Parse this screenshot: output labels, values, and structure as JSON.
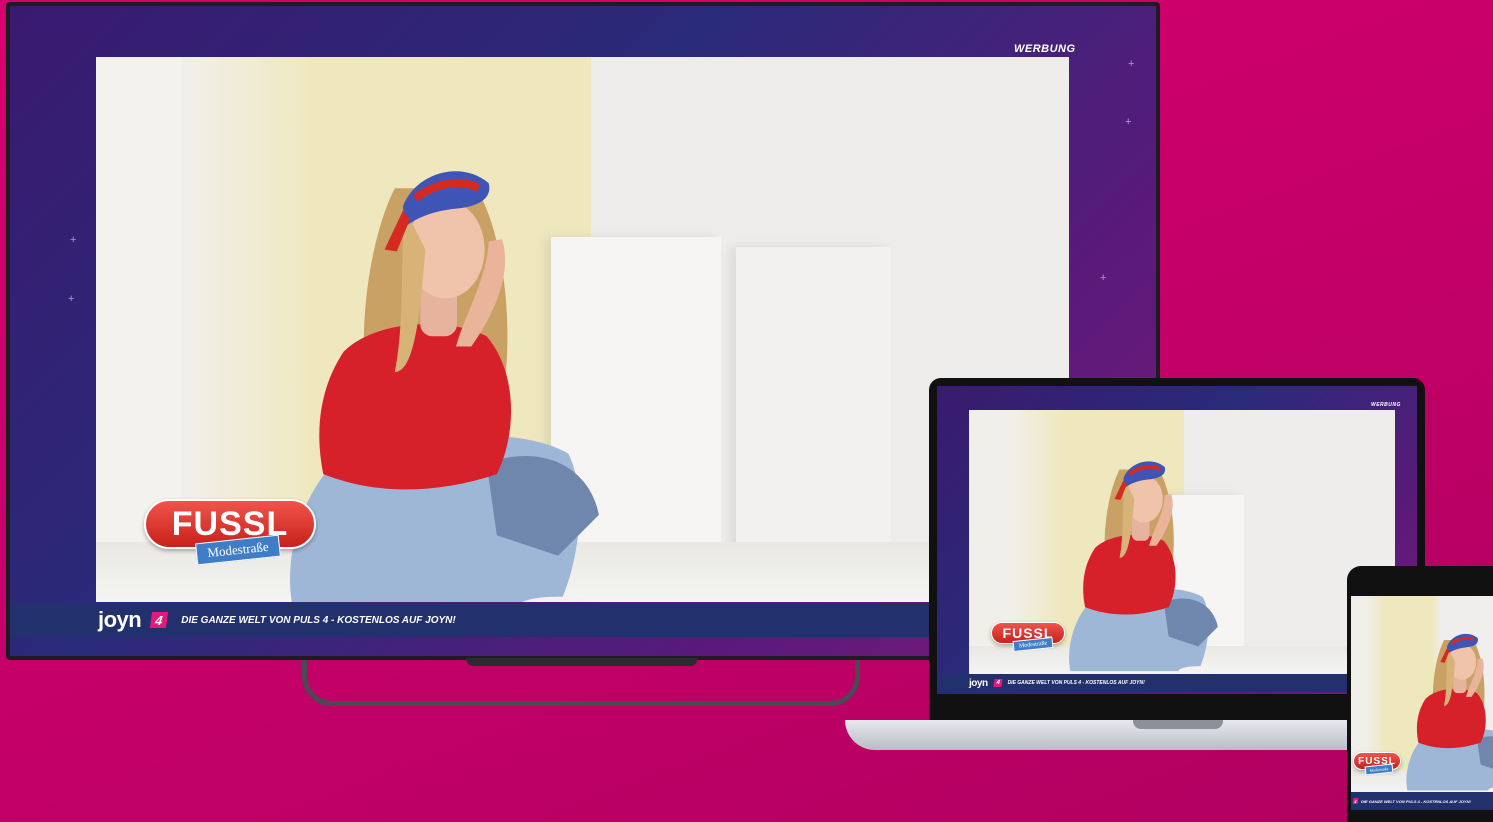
{
  "ad_label": "WERBUNG",
  "brand": {
    "logo_text": "joyn",
    "channel_number": "4"
  },
  "ticker_text": "DIE GANZE WELT VON PULS 4 - KOSTENLOS AUF JOYN!",
  "advertiser": {
    "name": "FUSSL",
    "tagline": "Modestraße"
  },
  "colors": {
    "background": "#d0006a",
    "screen_frame": "#3a1a6e",
    "ticker_bar": "#23306e",
    "channel_badge": "#e5197b",
    "advertiser_red": "#d42a22",
    "advertiser_blue": "#3f7ec6"
  },
  "devices": [
    "tv",
    "laptop",
    "tablet"
  ]
}
